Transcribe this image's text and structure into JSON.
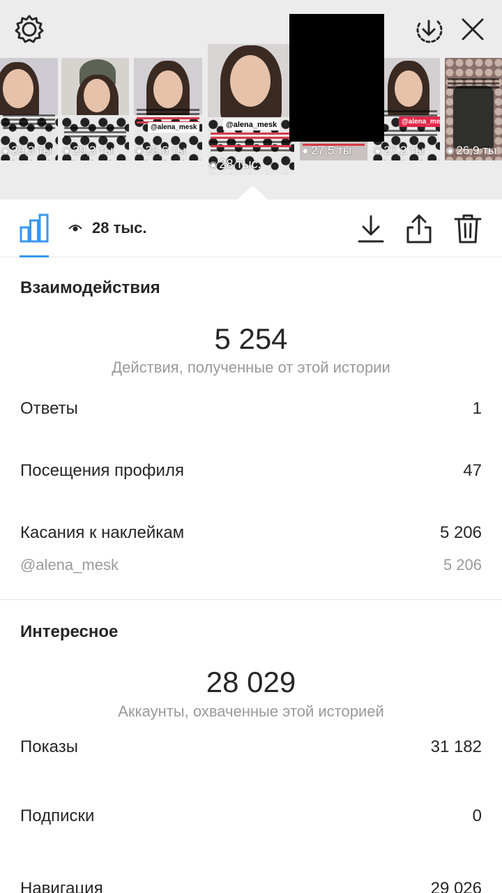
{
  "header": {
    "settings_icon": "gear-icon",
    "download_icon": "circle-download-icon",
    "close_icon": "close-icon"
  },
  "thumbnails": [
    {
      "views": "29,3 ты",
      "tag": ""
    },
    {
      "views": "29,3 ты",
      "tag": ""
    },
    {
      "views": "28,6 ты",
      "tag": "@alena_mesk"
    },
    {
      "views": "28 тыс.",
      "tag": "@alena_mesk"
    },
    {
      "views": "27,5 ты",
      "tag": ""
    },
    {
      "views": "27,2 ты",
      "tag": "@alena_mesk"
    },
    {
      "views": "26,9 ты",
      "tag": ""
    }
  ],
  "toolbar": {
    "views_label": "28 тыс.",
    "chart_icon": "bar-chart-icon",
    "eye_icon": "eye-icon",
    "download_icon": "download-icon",
    "share_icon": "share-icon",
    "delete_icon": "trash-icon"
  },
  "interactions": {
    "title": "Взаимодействия",
    "total": "5 254",
    "caption": "Действия, полученные от этой истории",
    "rows": [
      {
        "label": "Ответы",
        "value": "1"
      },
      {
        "label": "Посещения профиля",
        "value": "47"
      },
      {
        "label": "Касания к наклейкам",
        "value": "5 206"
      }
    ],
    "sub_row": {
      "label": "@alena_mesk",
      "value": "5 206"
    }
  },
  "discovery": {
    "title": "Интересное",
    "total": "28 029",
    "caption": "Аккаунты, охваченные этой историей",
    "rows": [
      {
        "label": "Показы",
        "value": "31 182"
      },
      {
        "label": "Подписки",
        "value": "0"
      },
      {
        "label": "Навигация",
        "value": "29 026"
      }
    ]
  },
  "colors": {
    "accent": "#3897f0",
    "top_bg": "#ececec",
    "text": "#262626",
    "muted": "#9a9a9a"
  }
}
